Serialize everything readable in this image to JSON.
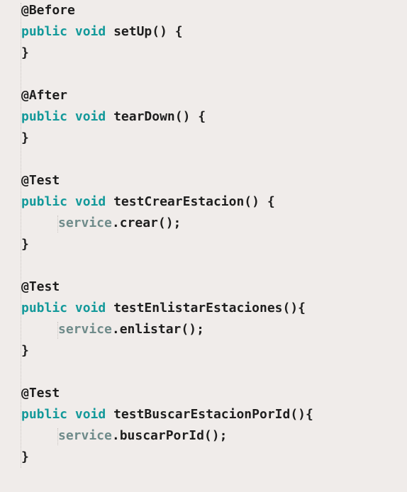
{
  "colors": {
    "background": "#f0ecea",
    "keyword": "#13999a",
    "field": "#6f8b8a",
    "text": "#1e1e1e",
    "guide": "#c9c4c1"
  },
  "code": {
    "block1": {
      "annotation": "@Before",
      "modifier": "public",
      "type": "void",
      "signature": "setUp() {",
      "close": "}"
    },
    "block2": {
      "annotation": "@After",
      "modifier": "public",
      "type": "void",
      "signature": "tearDown() {",
      "close": "}"
    },
    "block3": {
      "annotation": "@Test",
      "modifier": "public",
      "type": "void",
      "signature": "testCrearEstacion() {",
      "body_field": "service",
      "body_call": ".crear();",
      "close": "}"
    },
    "block4": {
      "annotation": "@Test",
      "modifier": "public",
      "type": "void",
      "signature": "testEnlistarEstaciones(){",
      "body_field": "service",
      "body_call": ".enlistar();",
      "close": "}"
    },
    "block5": {
      "annotation": "@Test",
      "modifier": "public",
      "type": "void",
      "signature": "testBuscarEstacionPorId(){",
      "body_field": "service",
      "body_call": ".buscarPorId();",
      "close": "}"
    }
  }
}
